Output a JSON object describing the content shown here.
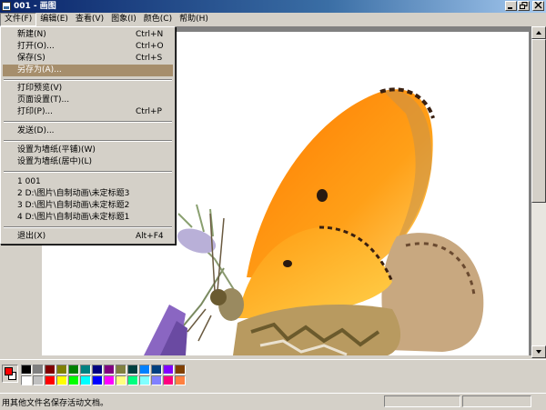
{
  "window": {
    "title": "001 - 画图"
  },
  "menubar": [
    "文件(F)",
    "编辑(E)",
    "查看(V)",
    "图象(I)",
    "颜色(C)",
    "帮助(H)"
  ],
  "file_menu": {
    "items": [
      {
        "label": "新建(N)",
        "shortcut": "Ctrl+N"
      },
      {
        "label": "打开(O)...",
        "shortcut": "Ctrl+O"
      },
      {
        "label": "保存(S)",
        "shortcut": "Ctrl+S"
      },
      {
        "label": "另存为(A)...",
        "shortcut": ""
      },
      {
        "label": "打印预览(V)",
        "shortcut": ""
      },
      {
        "label": "页面设置(T)...",
        "shortcut": ""
      },
      {
        "label": "打印(P)...",
        "shortcut": "Ctrl+P"
      },
      {
        "label": "发送(D)...",
        "shortcut": ""
      },
      {
        "label": "设置为墙纸(平铺)(W)",
        "shortcut": ""
      },
      {
        "label": "设置为墙纸(居中)(L)",
        "shortcut": ""
      },
      {
        "label": "1 001",
        "shortcut": ""
      },
      {
        "label": "2 D:\\图片\\自制动画\\未定标题3",
        "shortcut": ""
      },
      {
        "label": "3 D:\\图片\\自制动画\\未定标题2",
        "shortcut": ""
      },
      {
        "label": "4 D:\\图片\\自制动画\\未定标题1",
        "shortcut": ""
      },
      {
        "label": "退出(X)",
        "shortcut": "Alt+F4"
      }
    ],
    "highlighted": "另存为(A)..."
  },
  "colors": {
    "foreground": "#ff0000",
    "background": "#ffffff",
    "palette": [
      "#000000",
      "#808080",
      "#800000",
      "#808000",
      "#008000",
      "#008080",
      "#000080",
      "#800080",
      "#808040",
      "#004040",
      "#0080ff",
      "#004080",
      "#8000ff",
      "#804000",
      "#ffffff",
      "#c0c0c0",
      "#ff0000",
      "#ffff00",
      "#00ff00",
      "#00ffff",
      "#0000ff",
      "#ff00ff",
      "#ffff80",
      "#00ff80",
      "#80ffff",
      "#8080ff",
      "#ff0080",
      "#ff8040"
    ]
  },
  "statusbar": {
    "text": "用其他文件名保存活动文档。"
  }
}
